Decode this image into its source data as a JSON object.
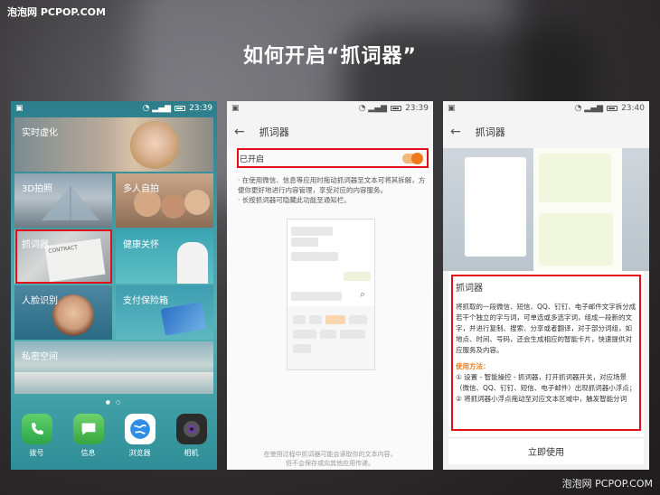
{
  "watermark_top": "泡泡网 PCPOP.COM",
  "watermark_bottom": "泡泡网 PCPOP.COM",
  "headline": "如何开启“抓词器”",
  "phone1": {
    "time": "23:39",
    "tiles": {
      "vr": "实时虚化",
      "photo3d": "3D拍照",
      "multi_selfie": "多人自拍",
      "word_grab": "抓词器",
      "health": "健康关怀",
      "face_id": "人脸识别",
      "pay_box": "支付保险箱",
      "private_space": "私密空间"
    },
    "tile_extra": {
      "contract": "CONTRACT"
    },
    "dock": [
      "拨号",
      "信息",
      "浏览器",
      "相机"
    ]
  },
  "phone2": {
    "time": "23:39",
    "title": "抓词器",
    "toggle_label": "已开启",
    "toggle_on": true,
    "desc1": "· 在使用微信、信息等应用时拖动抓词器至文本可将其拆解，方便你更好地进行内容管理，享受对应的内容服务。",
    "desc2": "· 长按抓词器可隐藏此功能至通知栏。",
    "footer1": "在使用过程中抓词器可能会读取你的文本内容，",
    "footer2": "但不会保存或向其他应用传递。"
  },
  "phone3": {
    "time": "23:40",
    "title": "抓词器",
    "card_title": "抓词器",
    "card_body": "将抓取的一段微信、短信、QQ、钉钉、电子邮件文字拆分成若干个独立的字与词，可单选或多选字词，组成一段新的文字，并进行复制、搜索、分享或者翻译，对于部分词组，如地点、时间、号码，还会生成相应的智能卡片，快速提供对应服务及内容。",
    "card_subtitle": "使用方法：",
    "step1": "① 设置 - 智能操控 - 抓词器，打开抓词器开关，对应场景（微信、QQ、钉钉、短信、电子邮件）出现抓词器小浮点；",
    "step2": "② 将抓词器小浮点拖动至对应文本区域中，触发智能分词",
    "use_button": "立即使用"
  },
  "colors": {
    "highlight": "#e3101b",
    "accent": "#f07a1b"
  }
}
